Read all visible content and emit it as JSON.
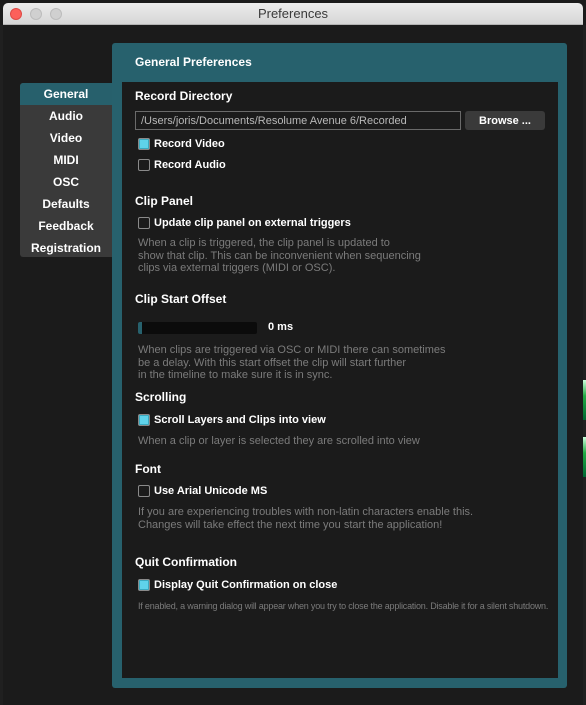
{
  "window": {
    "title": "Preferences"
  },
  "nav": {
    "items": [
      {
        "label": "General",
        "active": true
      },
      {
        "label": "Audio",
        "active": false
      },
      {
        "label": "Video",
        "active": false
      },
      {
        "label": "MIDI",
        "active": false
      },
      {
        "label": "OSC",
        "active": false
      },
      {
        "label": "Defaults",
        "active": false
      },
      {
        "label": "Feedback",
        "active": false
      },
      {
        "label": "Registration",
        "active": false
      }
    ]
  },
  "panel": {
    "title": "General Preferences",
    "record_directory": {
      "title": "Record Directory",
      "path_value": "/Users/joris/Documents/Resolume Avenue 6/Recorded",
      "browse_label": "Browse ...",
      "record_video": {
        "label": "Record Video",
        "checked": true
      },
      "record_audio": {
        "label": "Record Audio",
        "checked": false
      }
    },
    "clip_panel": {
      "title": "Clip Panel",
      "update_clip_panel": {
        "label": "Update clip panel on external triggers",
        "checked": false
      },
      "description": [
        "When a clip is triggered, the clip panel is updated to",
        "show that clip. This can be inconvenient when sequencing",
        "clips via external triggers (MIDI or OSC)."
      ]
    },
    "clip_start_offset": {
      "title": "Clip Start Offset",
      "slider_fraction": 0,
      "value_label": "0 ms",
      "description": [
        "When clips are triggered via OSC or MIDI there can sometimes",
        "be a delay. With this start offset the clip will start further",
        "in the timeline to make sure it is in sync."
      ]
    },
    "scrolling": {
      "title": "Scrolling",
      "scroll_into_view": {
        "label": "Scroll Layers and Clips into view",
        "checked": true
      },
      "description": [
        "When a clip or layer is selected they are scrolled into view"
      ]
    },
    "font": {
      "title": "Font",
      "use_arial_unicode": {
        "label": "Use Arial Unicode MS",
        "checked": false
      },
      "description": [
        "If you are experiencing troubles with non-latin characters enable this.",
        "Changes will take effect the next time you start the application!"
      ]
    },
    "quit_confirmation": {
      "title": "Quit Confirmation",
      "display_quit": {
        "label": "Display Quit Confirmation on close",
        "checked": true
      },
      "description": [
        "If enabled, a warning dialog will appear when you try to close the application. Disable it for a silent shutdown."
      ]
    }
  },
  "colors": {
    "accent": "#27616d",
    "checkbox_checked": "#5fd3ea",
    "background": "#1b1b1b"
  }
}
